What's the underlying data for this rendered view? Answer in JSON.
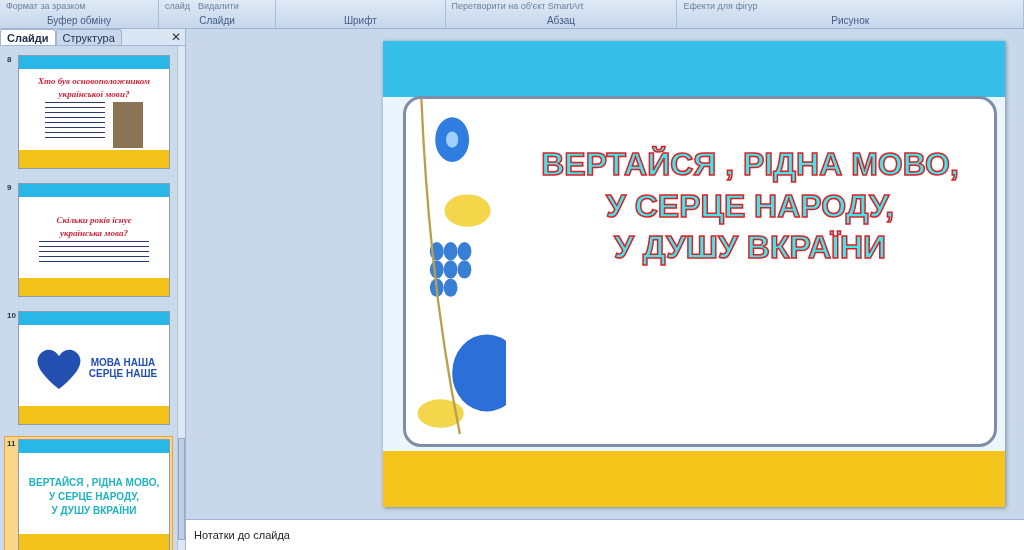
{
  "ribbon": {
    "groups": [
      {
        "label": "Буфер обміну",
        "items": [
          "Формат за зразком"
        ]
      },
      {
        "label": "Слайди",
        "items": [
          "слайд",
          "Видалити"
        ]
      },
      {
        "label": "Шрифт"
      },
      {
        "label": "Абзац",
        "items": [
          "Перетворити на об'єкт SmartArt"
        ]
      },
      {
        "label": "Рисунок",
        "items": [
          "Ефекти для фігур"
        ]
      }
    ]
  },
  "panel": {
    "close": "✕",
    "tabs": [
      {
        "label": "Слайди",
        "selected": true
      },
      {
        "label": "Структура",
        "selected": false
      }
    ],
    "slides": [
      {
        "number": "8",
        "kind": "text-photo",
        "selected": false,
        "title": [
          "Хто був основоположником",
          "української мови?"
        ]
      },
      {
        "number": "9",
        "kind": "text",
        "selected": false,
        "title": [
          "Скільки років існує",
          "українська мова?"
        ]
      },
      {
        "number": "10",
        "kind": "heart",
        "selected": false,
        "title": [
          "МОВА НАША",
          "СЕРЦЕ НАШЕ"
        ]
      },
      {
        "number": "11",
        "kind": "banner",
        "selected": true,
        "title": [
          "ВЕРТАЙСЯ , РІДНА МОВО,",
          "У СЕРЦЕ НАРОДУ,",
          "У ДУШУ ВКРАЇНИ"
        ]
      }
    ]
  },
  "slide": {
    "title": [
      "ВЕРТАЙСЯ , РІДНА МОВО,",
      "У СЕРЦЕ НАРОДУ,",
      "У ДУШУ ВКРАЇНИ"
    ]
  },
  "notes": {
    "placeholder": "Нотатки до слайда"
  }
}
